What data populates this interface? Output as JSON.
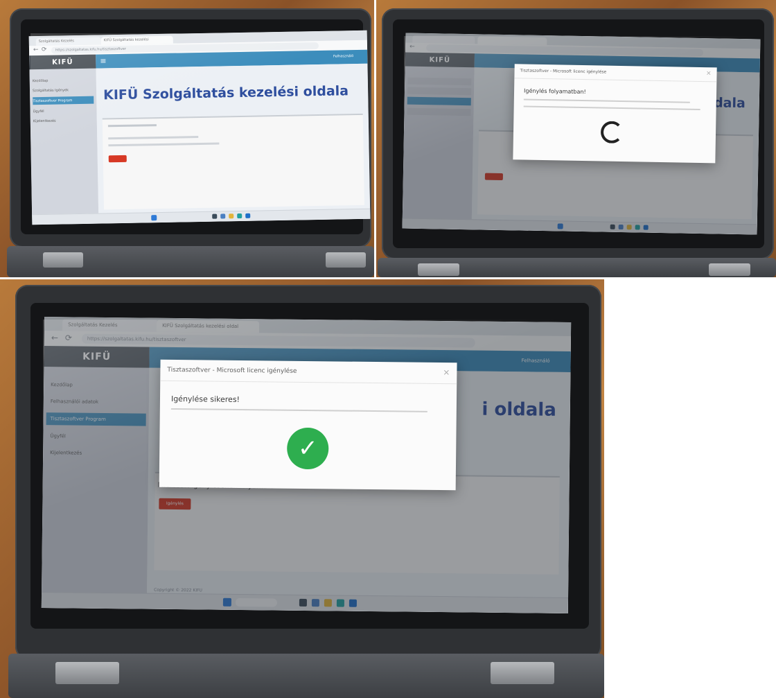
{
  "photo_top_left": {
    "tabs": [
      "Szolgáltatás Kezelés",
      "KIFÜ Szolgáltatás kezelési"
    ],
    "url": "https://szolgaltatas.kifu.hu/tisztaszoftver",
    "logo": "KIFÜ",
    "sidebar": [
      "Kezdőlap",
      "Szolgáltatás Igények",
      "Tisztaszoftver Program",
      "Ügyfél",
      "Kijelentkezés"
    ],
    "heading": "KIFÜ Szolgáltatás kezelési oldala",
    "user": "Felhasználó"
  },
  "photo_top_right": {
    "modal_title": "Tisztaszoftver - Microsoft licenc igénylése",
    "modal_heading": "Igénylés folyamatban!",
    "heading_fragment": "i oldala"
  },
  "photo_bottom": {
    "tabs": [
      "Szolgáltatás Kezelés",
      "KIFÜ Szolgáltatás kezelési oldal"
    ],
    "url": "https://szolgaltatas.kifu.hu/tisztaszoftver",
    "logo": "KIFÜ",
    "sidebar": [
      "Kezdőlap",
      "Felhasználói adatok",
      "Tisztaszoftver Program",
      "Ügyfél",
      "Kijelentkezés"
    ],
    "user": "Felhasználó",
    "modal_title": "Tisztaszoftver - Microsoft licenc igénylése",
    "modal_heading": "Igénylése sikeres!",
    "heading_fragment": "i oldala",
    "section_text": "Microsoft igénylésének folyamata",
    "button_label": "Igénylés",
    "footer": "Copyright © 2022 KIFÜ"
  },
  "icons": {
    "back": "←",
    "refresh": "⟳",
    "close": "×",
    "check": "✓",
    "menu": "≡"
  },
  "colors": {
    "accent": "#3c8dbc",
    "heading": "#2e4e9e",
    "danger": "#d73925",
    "success": "#2eae4f"
  }
}
